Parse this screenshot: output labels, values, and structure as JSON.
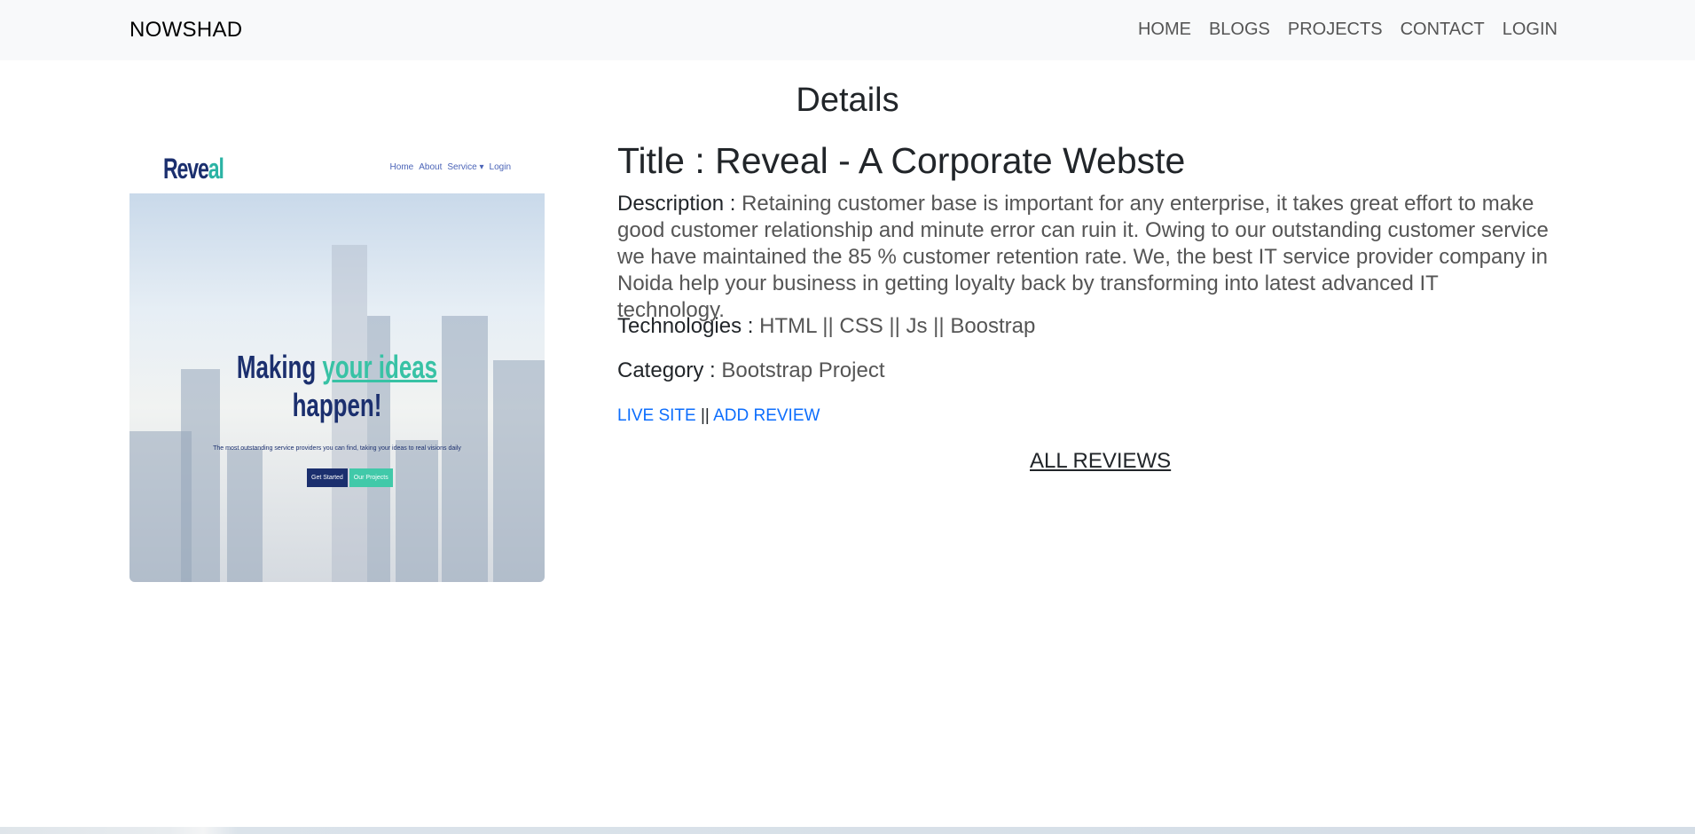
{
  "brand": "NOWSHAD",
  "nav": [
    "HOME",
    "BLOGS",
    "PROJECTS",
    "CONTACT",
    "LOGIN"
  ],
  "page_title": "Details",
  "screenshot": {
    "logo_main": "Reve",
    "logo_accent": "al",
    "mini_nav": [
      "Home",
      "About",
      "Service ▾",
      "Login"
    ],
    "headline_1": "Making ",
    "headline_accent": "your ideas",
    "headline_2": "happen!",
    "tagline": "The most outstanding service providers you can find, taking your ideas to real visions daily",
    "button_1": "Get Started",
    "button_2": "Our Projects"
  },
  "project": {
    "title": "Title : Reveal - A Corporate Webste",
    "description_label": "Description :",
    "description": "Retaining customer base is important for any enterprise, it takes great effort to make good customer relationship and minute error can ruin it. Owing to our outstanding customer service we have maintained the 85 % customer retention rate. We, the best IT service provider company in Noida help your business in getting loyalty back by transforming into latest advanced IT technology.",
    "technologies_label": "Technologies :",
    "technologies": "HTML || CSS || Js || Boostrap",
    "category_label": "Category :",
    "category": "Bootstrap Project",
    "live_site": "LIVE SITE",
    "separator": "||",
    "add_review": "ADD REVIEW",
    "all_reviews": "ALL REVIEWS"
  }
}
